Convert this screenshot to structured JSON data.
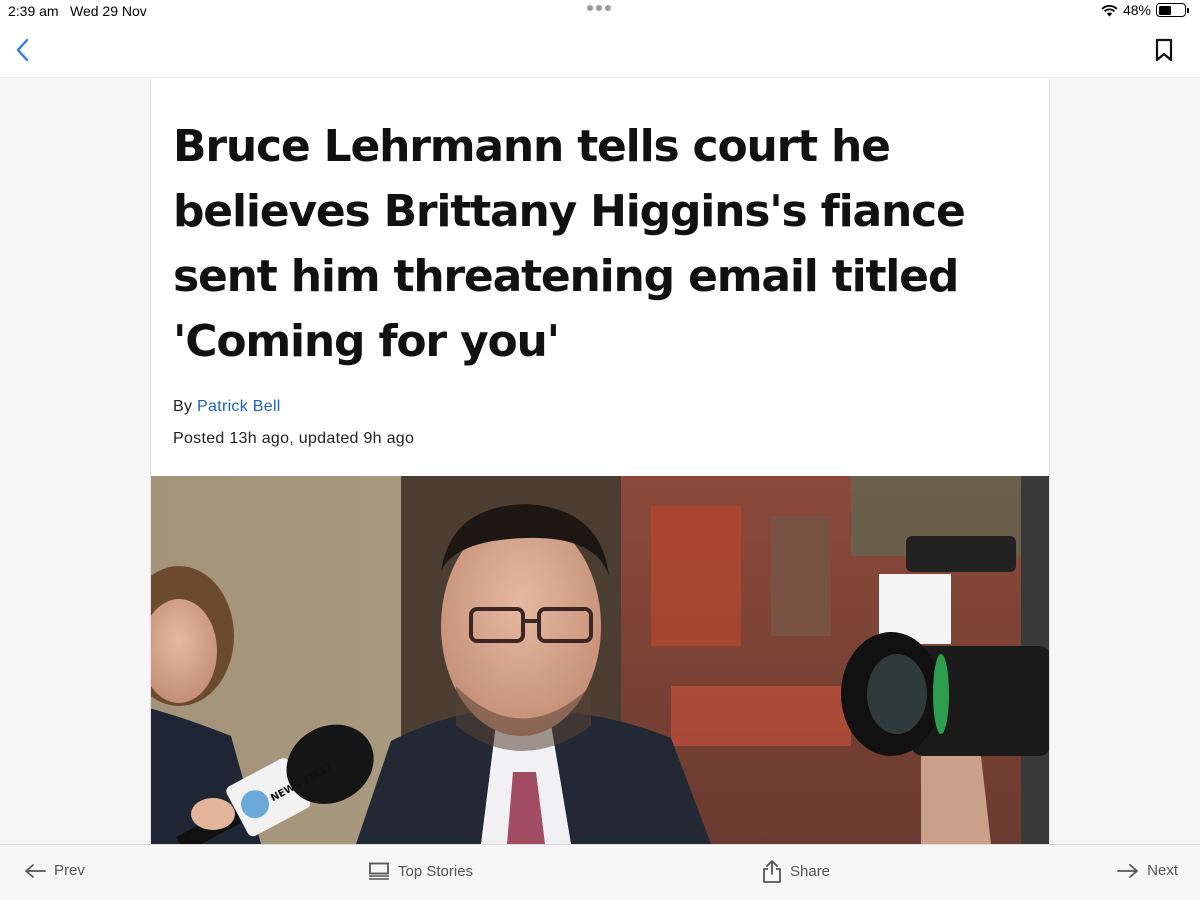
{
  "status_bar": {
    "time": "2:39 am",
    "date": "Wed 29 Nov",
    "battery_percent": "48%",
    "battery_level": 0.48
  },
  "nav": {
    "back_icon": "chevron-left-icon",
    "bookmark_icon": "bookmark-icon",
    "accent_color": "#2f7de1"
  },
  "article": {
    "headline": "Bruce Lehrmann tells court he believes Brittany Higgins's fiance sent him threatening email titled 'Coming for you'",
    "byline_prefix": "By",
    "author": "Patrick Bell",
    "posted": "Posted 13h ago, updated 9h ago",
    "hero_microphone_label": "NEWS FIRST",
    "author_link_color": "#1c5fc7"
  },
  "toolbar": {
    "prev_label": "Prev",
    "top_stories_label": "Top Stories",
    "share_label": "Share",
    "next_label": "Next"
  }
}
